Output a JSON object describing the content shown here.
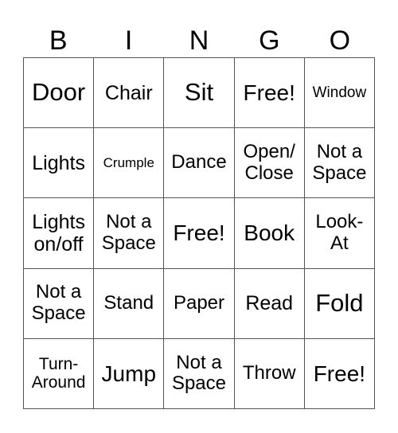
{
  "header": [
    "B",
    "I",
    "N",
    "G",
    "O"
  ],
  "cells": [
    [
      "Door",
      "Chair",
      "Sit",
      "Free!",
      "Window"
    ],
    [
      "Lights",
      "Crumple",
      "Dance",
      "Open/\nClose",
      "Not a\nSpace"
    ],
    [
      "Lights\non/off",
      "Not a\nSpace",
      "Free!",
      "Book",
      "Look-\nAt"
    ],
    [
      "Not a\nSpace",
      "Stand",
      "Paper",
      "Read",
      "Fold"
    ],
    [
      "Turn-\nAround",
      "Jump",
      "Not a\nSpace",
      "Throw",
      "Free!"
    ]
  ]
}
